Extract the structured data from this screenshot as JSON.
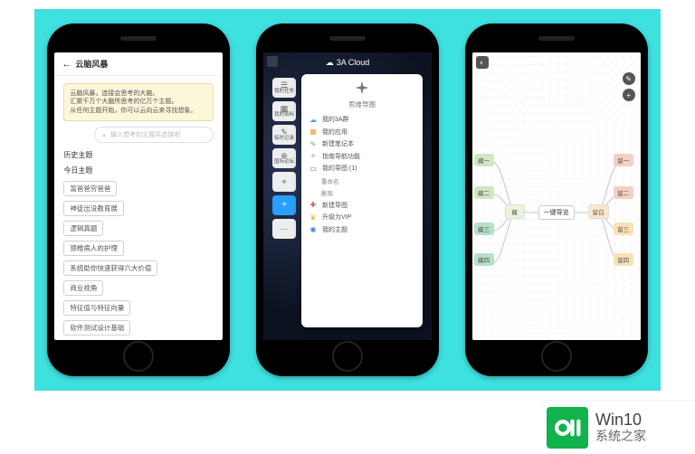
{
  "phone1": {
    "header_title": "云脑风暴",
    "card_line1": "云脑风暴，连接会思考的大脑。",
    "card_line2": "汇聚千万个大脑所思考的亿万个主题。",
    "card_line3": "从任何主题开始，你可以云向云来寻找想象。",
    "input_placeholder": "输入想考的主题并选择吧",
    "history_title": "历史主题",
    "today_title": "今日主题",
    "chips": [
      "富爸爸穷爸爸",
      "神徒出没教育展",
      "逻辑真题",
      "颈椎病人的护理",
      "系统助你快速获得六大价值",
      "商业视角",
      "特征值与特征向量",
      "软件测试设计基础"
    ]
  },
  "phone2": {
    "brand": "3A Cloud",
    "left_items": [
      "我的任务",
      "我的资料",
      "临时记录",
      "国际论坛",
      "",
      "+",
      ""
    ],
    "panel_title": "思维导图",
    "menu": [
      {
        "icon": "☁",
        "label": "我的3A群"
      },
      {
        "icon": "▦",
        "label": "我的应用"
      },
      {
        "icon": "✎",
        "label": "新建笔记本"
      },
      {
        "icon": "↗",
        "label": "指南导航功能"
      },
      {
        "icon": "▭",
        "label": "我的导图 (1)"
      },
      {
        "indent": true,
        "label": "重命名"
      },
      {
        "indent": true,
        "label": "删除"
      },
      {
        "icon": "+",
        "label": "新建导图",
        "red": true
      },
      {
        "icon": "♛",
        "label": "升级为VIP",
        "gold": true
      },
      {
        "icon": "●",
        "label": "我的主题",
        "blue": true
      }
    ]
  },
  "phone3": {
    "center": "一键导览",
    "left_group": {
      "label": "藏",
      "children": [
        "藏一",
        "藏二",
        "藏三",
        "藏四"
      ]
    },
    "right_group": {
      "label": "留白",
      "children": [
        "留一",
        "留二",
        "留三",
        "留四"
      ]
    }
  },
  "watermark": {
    "l1": "Win10",
    "l2": "系统之家"
  }
}
